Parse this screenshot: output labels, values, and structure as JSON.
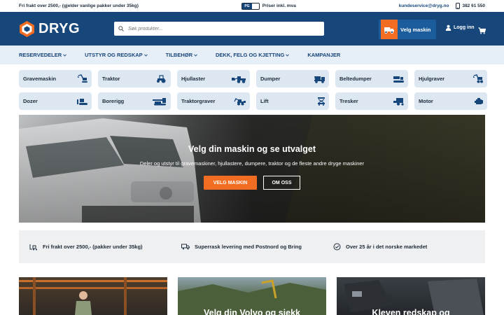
{
  "topbar": {
    "shipping_note": "Fri frakt over 2500,- (gjelder vanlige pakker under 35kg)",
    "price_toggle_label": "PG",
    "price_note": "Priser inkl. mva",
    "email": "kundeservice@dryg.no",
    "phone": "382 61 550"
  },
  "header": {
    "brand": "DRYG",
    "search_placeholder": "Søk produkter...",
    "velg_maskin_label": "Velg maskin",
    "login_label": "Logg inn"
  },
  "nav": {
    "items": [
      {
        "label": "RESERVEDELER",
        "has_dropdown": true
      },
      {
        "label": "UTSTYR OG REDSKAP",
        "has_dropdown": true
      },
      {
        "label": "TILBEHØR",
        "has_dropdown": true
      },
      {
        "label": "DEKK, FELG OG KJETTING",
        "has_dropdown": true
      },
      {
        "label": "KAMPANJER",
        "has_dropdown": false
      }
    ]
  },
  "categories": [
    {
      "label": "Gravemaskin",
      "icon": "excavator-icon"
    },
    {
      "label": "Traktor",
      "icon": "tractor-icon"
    },
    {
      "label": "Hjullaster",
      "icon": "wheel-loader-icon"
    },
    {
      "label": "Dumper",
      "icon": "dumper-icon"
    },
    {
      "label": "Beltedumper",
      "icon": "track-dumper-icon"
    },
    {
      "label": "Hjulgraver",
      "icon": "wheeled-excavator-icon"
    },
    {
      "label": "Dozer",
      "icon": "dozer-icon"
    },
    {
      "label": "Borerigg",
      "icon": "drill-rig-icon"
    },
    {
      "label": "Traktorgraver",
      "icon": "backhoe-icon"
    },
    {
      "label": "Lift",
      "icon": "lift-icon"
    },
    {
      "label": "Tresker",
      "icon": "harvester-icon"
    },
    {
      "label": "Motor",
      "icon": "engine-icon"
    }
  ],
  "hero": {
    "title": "Velg din maskin og se utvalget",
    "subtitle": "Deler og utstyr til gravemaskiner, hjullastere, dumpere, traktor og de fleste andre dryge maskiner",
    "primary_button": "VELG MASKIN",
    "secondary_button": "OM OSS"
  },
  "usps": [
    {
      "text": "Fri frakt over 2500,- (pakker under 35kg)",
      "icon": "forklift-icon"
    },
    {
      "text": "Superrask levering med Postnord og Bring",
      "icon": "delivery-truck-icon"
    },
    {
      "text": "Over 25 år i det norske markedet",
      "icon": "badge-check-icon"
    }
  ],
  "tiles": [
    {
      "text": ""
    },
    {
      "text": "Velg din Volvo og sjekk"
    },
    {
      "text": "Kleven redskap og"
    }
  ],
  "colors": {
    "brand_blue": "#17467a",
    "accent_orange": "#f26d21",
    "category_bg": "#dce7f2",
    "nav_bg": "#e6eef7"
  }
}
